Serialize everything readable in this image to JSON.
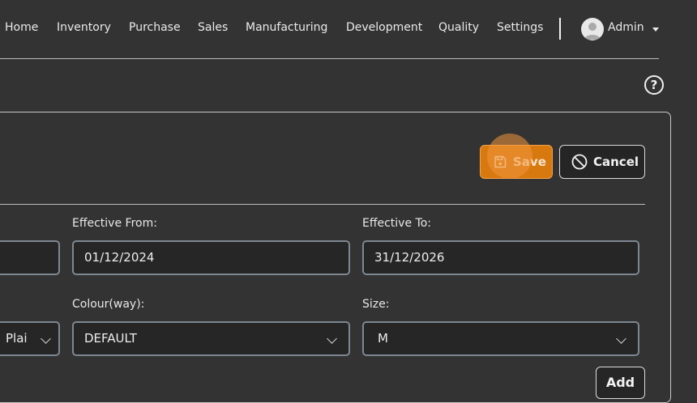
{
  "nav": {
    "items": [
      "Home",
      "Inventory",
      "Purchase",
      "Sales",
      "Manufacturing",
      "Development",
      "Quality",
      "Settings"
    ],
    "user_label": "Admin"
  },
  "help_icon": "help-circle-icon",
  "toolbar": {
    "save_label": "Save",
    "cancel_label": "Cancel",
    "save_icon": "floppy-disk-icon",
    "cancel_icon": "no-entry-icon"
  },
  "form": {
    "row1": {
      "left_value": "",
      "effective_from_label": "Effective From:",
      "effective_from_value": "01/12/2024",
      "effective_to_label": "Effective To:",
      "effective_to_value": "31/12/2026"
    },
    "row2": {
      "left_select_value": "Plai",
      "colourway_label": "Colour(way):",
      "colourway_value": "DEFAULT",
      "size_label": "Size:",
      "size_value": "M"
    },
    "add_label": "Add"
  },
  "colors": {
    "background": "#333333",
    "accent": "#d8790f",
    "input_border": "#7d8790"
  }
}
